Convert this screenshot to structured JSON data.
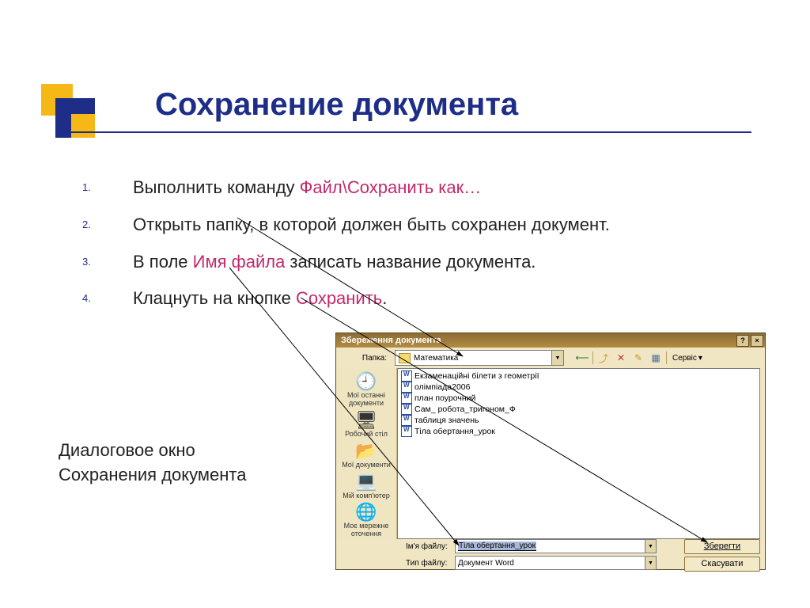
{
  "slide": {
    "title": "Сохранение документа",
    "steps": [
      {
        "prefix": "Выполнить команду ",
        "highlight": "Файл\\Сохранить как…",
        "suffix": ""
      },
      {
        "prefix": "Открыть папку, в которой должен быть сохранен документ.",
        "highlight": "",
        "suffix": ""
      },
      {
        "prefix": "В поле ",
        "highlight": "Имя файла",
        "suffix": " записать название документа."
      },
      {
        "prefix": "Клацнуть на кнопке ",
        "highlight": "Сохранить",
        "suffix": "."
      }
    ],
    "caption_line1": "Диалоговое окно",
    "caption_line2": "Сохранения документа"
  },
  "dialog": {
    "title": "Збереження документа",
    "help_glyph": "?",
    "close_glyph": "×",
    "folder_label": "Папка:",
    "current_folder": "Математика",
    "folder_arrow": "▼",
    "toolbar": {
      "back": "⟵",
      "up": "⤴",
      "search": "✕",
      "new": "✎",
      "views": "▦",
      "service": "Сервіс",
      "service_arrow": "▾"
    },
    "sidebar": [
      {
        "icon": "🕘",
        "label": "Мої останні документи"
      },
      {
        "icon": "🖥",
        "label": "Робочий стіл"
      },
      {
        "icon": "📂",
        "label": "Мої документи"
      },
      {
        "icon": "💻",
        "label": "Мій комп'ютер"
      },
      {
        "icon": "🌐",
        "label": "Моє мережне оточення"
      }
    ],
    "files": [
      "Екзаменаційні білети з геометрії",
      "олімпіада2006",
      "план поурочний",
      "Сам_ робота_тригоном_Ф",
      "таблиця значень",
      "Тіла обертання_урок"
    ],
    "filename_label": "Ім'я файлу:",
    "filename_value": "Тіла обертання_урок",
    "filetype_label": "Тип файлу:",
    "filetype_value": "Документ Word",
    "save_btn": "Зберегти",
    "cancel_btn": "Скасувати"
  }
}
